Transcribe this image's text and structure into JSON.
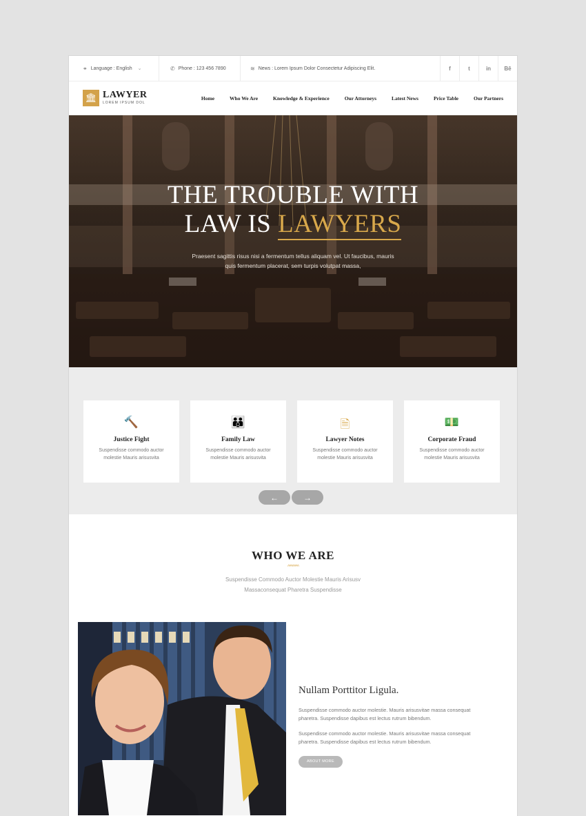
{
  "topbar": {
    "language": "Language : English",
    "phone": "Phone : 123 456 7890",
    "news": "News : Lorem Ipsum Dolor Consectetur Adipiscing Elit.",
    "socials": [
      "f",
      "t",
      "in",
      "Bē"
    ]
  },
  "logo": {
    "title": "LAWYER",
    "subtitle": "LOREM IPSUM DOL"
  },
  "menu": [
    "Home",
    "Who We Are",
    "Knowledge & Experience",
    "Our Attorneys",
    "Latest News",
    "Price Table",
    "Our Partners"
  ],
  "hero": {
    "title_line1": "THE TROUBLE WITH",
    "title_line2_a": "LAW IS",
    "title_line2_b": "LAWYERS",
    "subtitle": "Praesent sagittis risus nisi a fermentum tellus aliquam vel. Ut faucibus, mauris quis fermentum placerat, sem turpis volutpat massa,"
  },
  "services": [
    {
      "icon": "gavel-icon",
      "title": "Justice Fight",
      "desc": "Suspendisse commodo auctor molestie Mauris arisusvita"
    },
    {
      "icon": "family-icon",
      "title": "Family Law",
      "desc": "Suspendisse commodo auctor molestie Mauris arisusvita"
    },
    {
      "icon": "document-icon",
      "title": "Lawyer Notes",
      "desc": "Suspendisse commodo auctor molestie Mauris arisusvita"
    },
    {
      "icon": "money-icon",
      "title": "Corporate Fraud",
      "desc": "Suspendisse commodo auctor molestie Mauris arisusvita"
    }
  ],
  "arrows": {
    "prev": "←",
    "next": "→"
  },
  "who": {
    "title": "WHO WE ARE",
    "divider": "^^^^^^^",
    "line1": "Suspendisse Commodo Auctor Molestie Mauris Arisusv",
    "line2": "Massaconsequat Pharetra Suspendisse"
  },
  "about": {
    "title": "Nullam Porttitor Ligula.",
    "p1": "Suspendisse commodo auctor molestie. Mauris arisusvitae massa consequat pharetra. Suspendisse dapibus est lectus rutrum bibendum.",
    "p2": "Suspendisse commodo auctor molestie. Mauris arisusvitae massa consequat pharetra. Suspendisse dapibus est lectus rutrum bibendum.",
    "button": "ABOUT MORE"
  },
  "colors": {
    "accent": "#d8a84b",
    "background": "#e3e3e3"
  }
}
